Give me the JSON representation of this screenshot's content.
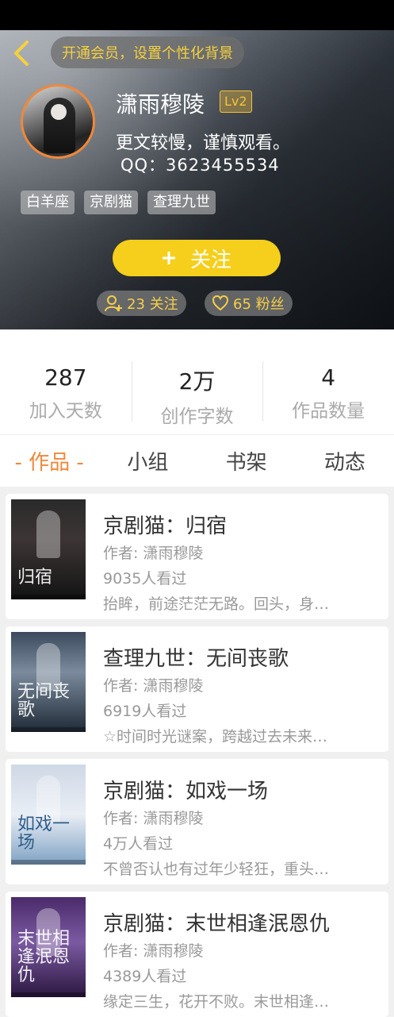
{
  "header": {
    "vip_banner": "开通会员，设置个性化背景",
    "username": "潇雨穆陵",
    "level": "Lv2",
    "bio": "更文较慢，谨慎观看。",
    "qq": "QQ：3623455534",
    "tags": [
      "白羊座",
      "京剧猫",
      "查理九世"
    ],
    "follow_button": "关注",
    "following_count": "23 关注",
    "fans_count": "65 粉丝"
  },
  "stats": [
    {
      "value": "287",
      "label": "加入天数"
    },
    {
      "value": "2万",
      "label": "创作字数"
    },
    {
      "value": "4",
      "label": "作品数量"
    }
  ],
  "tabs": [
    "- 作品 -",
    "小组",
    "书架",
    "动态"
  ],
  "works": [
    {
      "title": "京剧猫：归宿",
      "author": "作者: 潇雨穆陵",
      "views": "9035人看过",
      "desc": "抬眸，前途茫茫无路。回头，身…",
      "cover_text": "归宿"
    },
    {
      "title": "查理九世：无间丧歌",
      "author": "作者: 潇雨穆陵",
      "views": "6919人看过",
      "desc": "☆时间时光谜案，跨越过去未来…",
      "cover_text": "无间丧歌"
    },
    {
      "title": "京剧猫：如戏一场",
      "author": "作者: 潇雨穆陵",
      "views": "4万人看过",
      "desc": "不曾否认也有过年少轻狂，重头…",
      "cover_text": "如戏一场"
    },
    {
      "title": "京剧猫：末世相逢泯恩仇",
      "author": "作者: 潇雨穆陵",
      "views": "4389人看过",
      "desc": "缘定三生，花开不败。末世相逢…",
      "cover_text": "末世相逢泯恩仇"
    }
  ],
  "colors": {
    "accent": "#f0883a",
    "follow_button": "#f5cf1c",
    "vip_text": "#f5d13d"
  }
}
